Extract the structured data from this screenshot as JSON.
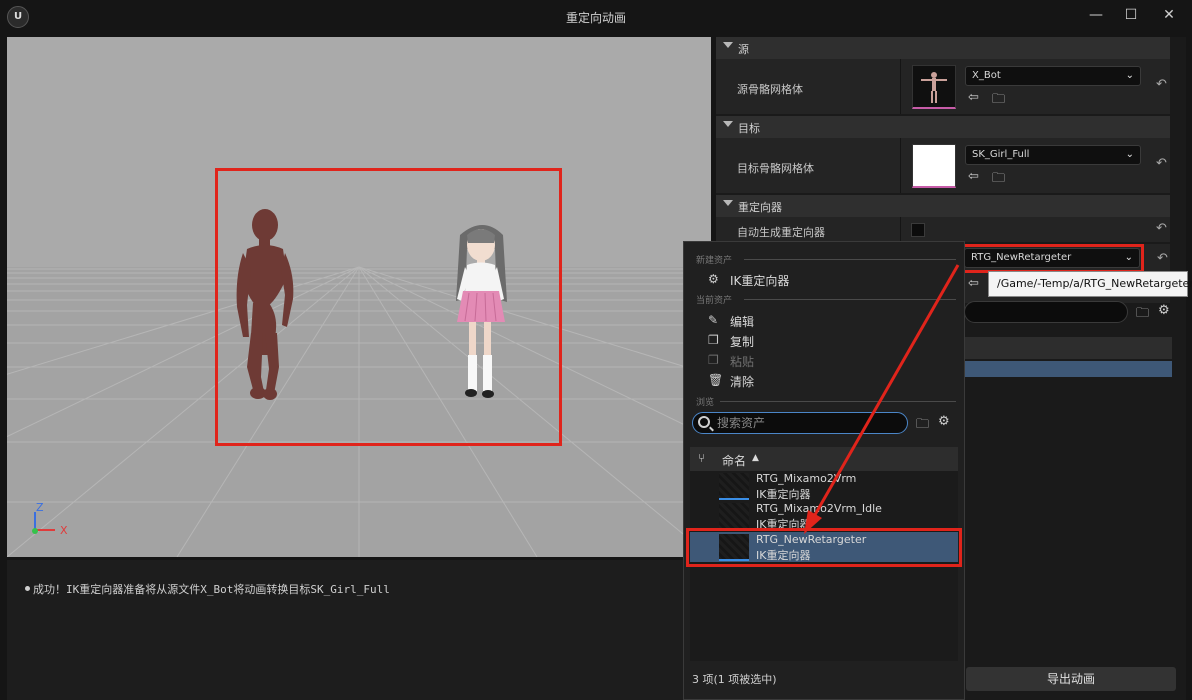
{
  "window": {
    "title": "重定向动画",
    "logo": "U",
    "minimize_glyph": "—",
    "maximize_glyph": "☐",
    "close_glyph": "✕"
  },
  "viewport": {
    "axis": {
      "z": "Z",
      "x": "X"
    },
    "colors": {
      "background": "#a9a9a9",
      "highlight": "#e0241b",
      "bot": "#6e3a35"
    }
  },
  "log": {
    "message": "成功！IK重定向器准备将从源文件X_Bot将动画转换目标SK_Girl_Full"
  },
  "panel": {
    "source_section": "源",
    "source_mesh_label": "源骨骼网格体",
    "source_mesh_value": "X_Bot",
    "target_section": "目标",
    "target_mesh_label": "目标骨骼网格体",
    "target_mesh_value": "SK_Girl_Full",
    "retargeter_section": "重定向器",
    "auto_gen_label": "自动生成重定向器",
    "retargeter_value": "RTG_NewRetargeter",
    "tooltip": "/Game/-Temp/a/RTG_NewRetargeter",
    "export_button": "导出动画",
    "chevron": "⌄",
    "reset_glyph": "↶"
  },
  "popup": {
    "new_asset_section": "新建资产",
    "ik_retargeter_item": "IK重定向器",
    "current_asset_section": "当前资产",
    "edit": "编辑",
    "copy": "复制",
    "paste": "粘贴",
    "clear": "清除",
    "browse_section": "浏览",
    "search_placeholder": "搜索资产",
    "column_name": "命名",
    "assets": [
      {
        "name": "RTG_Mixamo2Vrm",
        "type": "IK重定向器"
      },
      {
        "name": "RTG_Mixamo2Vrm_Idle",
        "type": "IK重定向器"
      },
      {
        "name": "RTG_NewRetargeter",
        "type": "IK重定向器"
      }
    ],
    "footer": "3 项(1 项被选中)"
  }
}
